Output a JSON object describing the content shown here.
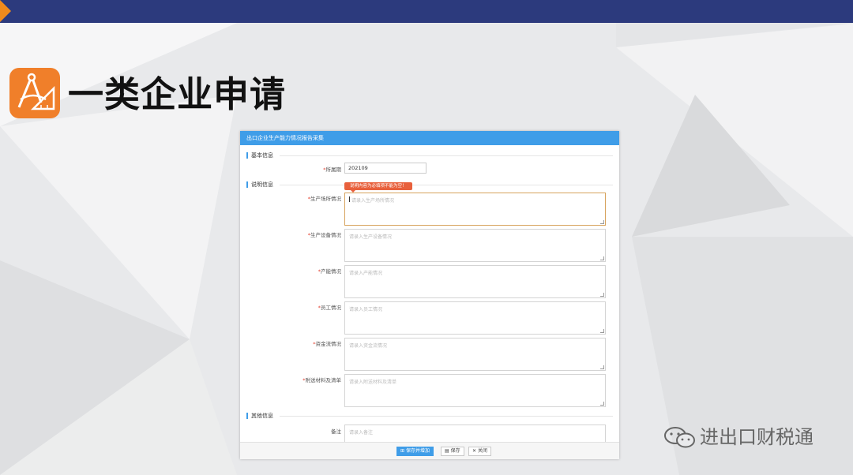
{
  "slide": {
    "title": "一类企业申请"
  },
  "form": {
    "header": "出口企业生产能力情况报告采集",
    "sections": {
      "basic": "基本信息",
      "description": "说明信息",
      "other": "其他信息"
    },
    "period": {
      "label": "所属期",
      "value": "202109"
    },
    "tooltip": "说明内容为必填项不能为空！",
    "fields": [
      {
        "label": "生产场所情况",
        "placeholder": "请录入生产场所情况",
        "required": true
      },
      {
        "label": "生产设备情况",
        "placeholder": "请录入生产设备情况",
        "required": true
      },
      {
        "label": "产能情况",
        "placeholder": "请录入产能情况",
        "required": true
      },
      {
        "label": "员工情况",
        "placeholder": "请录入员工情况",
        "required": true
      },
      {
        "label": "资金流情况",
        "placeholder": "请录入资金流情况",
        "required": true
      },
      {
        "label": "附送材料及清单",
        "placeholder": "请录入附送材料及清单",
        "required": true
      }
    ],
    "remark": {
      "label": "备注",
      "placeholder": "请录入备注"
    },
    "buttons": {
      "save_new": "保存并增加",
      "save": "保存",
      "close": "关闭"
    }
  },
  "watermark": {
    "text": "进出口财税通",
    "icon": "wechat-icon"
  },
  "colors": {
    "topbar": "#2c3a7d",
    "accent_orange": "#f08a1c",
    "form_blue": "#3f9de8",
    "tooltip_red": "#e8603c",
    "logo_orange": "#f07f2a"
  }
}
